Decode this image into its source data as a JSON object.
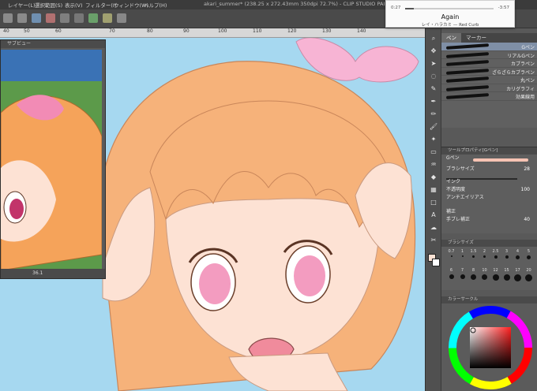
{
  "window": {
    "document_title": "akari_summer* (238.25 x 272.43mm 350dpi 72.7%)  - CLIP STUDIO PAINT PRO",
    "menu": [
      "レイヤー(L)",
      "選択範囲(S)",
      "表示(V)",
      "フィルター(I)",
      "ウィンドウ(W)",
      "ヘルプ(H)"
    ]
  },
  "ruler": {
    "ticks": [
      "40",
      "50",
      "60",
      "70",
      "80",
      "90",
      "100",
      "110",
      "120",
      "130",
      "140"
    ]
  },
  "navigator": {
    "title": "サブビュー",
    "zoom": "36.1"
  },
  "subtool": {
    "tabs": [
      "ペン",
      "マーカー"
    ],
    "brushes": [
      "Gペン",
      "リアルGペン",
      "カブラペン",
      "ざらざらカブラペン",
      "丸ペン",
      "カリグラフィ",
      "効果線用"
    ],
    "selected_index": 0
  },
  "tool_property": {
    "header": "ツールプロパティ[Gペン]",
    "current_tool": "Gペン",
    "brush_size_label": "ブラシサイズ",
    "brush_size_value": "28",
    "ink_label": "インク",
    "opacity_label": "不透明度",
    "opacity_value": "100",
    "antialias_label": "アンチエイリアス",
    "correction_label": "補正",
    "stabilization_label": "手ブレ補正",
    "stabilization_value": "40"
  },
  "brush_size_panel": {
    "header": "ブラシサイズ",
    "sizes": [
      "0.7",
      "1",
      "1.5",
      "2",
      "2.5",
      "3",
      "4",
      "5",
      "6",
      "7",
      "8",
      "10",
      "12",
      "15",
      "17",
      "20"
    ]
  },
  "color_panel": {
    "header": "カラーサークル"
  },
  "media": {
    "elapsed": "0:27",
    "duration": "-3:57",
    "progress": 0.1,
    "song": "Again",
    "artist": "レイ・ハラカミ — Red Curb"
  },
  "colors": {
    "sky": "#a6d8f0",
    "skin": "#fde2d4",
    "hair": "#f6b27a",
    "bow": "#f7b4d4",
    "eye": "#f39cc0",
    "selected_row": "#7f8fa6"
  }
}
